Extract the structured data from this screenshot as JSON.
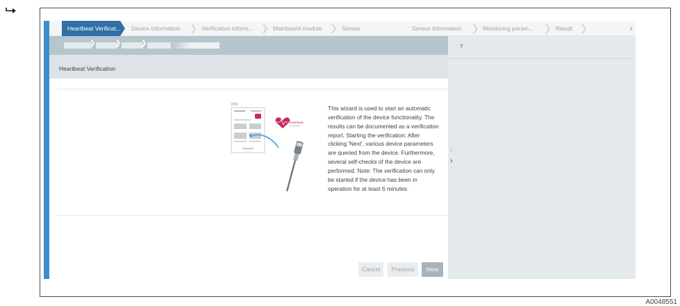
{
  "figure": {
    "id": "A0048551"
  },
  "wizard": {
    "steps": [
      {
        "label": "Heartbeat Verificat...",
        "active": true
      },
      {
        "label": "Device information",
        "active": false
      },
      {
        "label": "Verification inform...",
        "active": false
      },
      {
        "label": "Mainboard module",
        "active": false
      },
      {
        "label": "Sensor",
        "active": false
      },
      {
        "label": "Sensor information",
        "active": false
      },
      {
        "label": "Monitoring param...",
        "active": false
      },
      {
        "label": "Result",
        "active": false
      }
    ],
    "steps_next_glyph": "›",
    "title": "Heartbeat Verification",
    "description": "This wizard is used to start an automatic verification of the device functionality. The results can be documented as a verification report. Starting the verification: After clicking 'Next', various device parameters are queried from the device. Furthermore, several self-checks of the device are performed. Note: The verification can only be started if the device has been in operation for at least 6 minutes.",
    "buttons": {
      "cancel": "Cancel",
      "previous": "Previous",
      "next": "Next"
    }
  },
  "illustration": {
    "pdf_label": "PDF",
    "logo_text": "Heartbeat"
  },
  "help": {
    "question_mark": "?"
  },
  "pane_toggle": {
    "collapse_glyph": "‹",
    "expand_glyph": "›"
  },
  "colors": {
    "accent_blue": "#3b8fd0",
    "active_step": "#2f6fa6",
    "help_accent": "#c0163c",
    "help_background": "#e4e9ec"
  }
}
